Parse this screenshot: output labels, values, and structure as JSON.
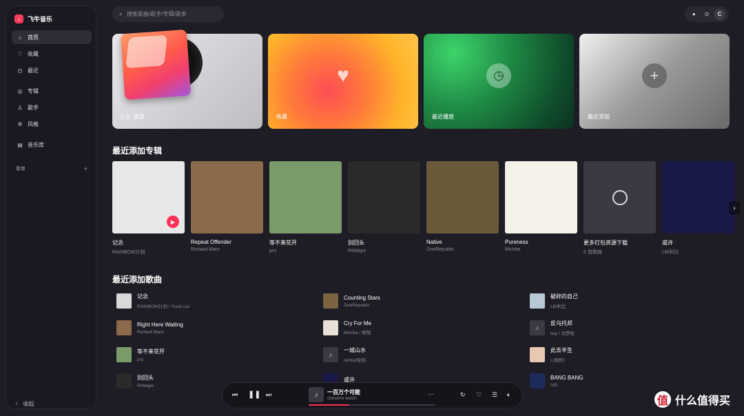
{
  "app": {
    "name": "飞牛音乐"
  },
  "sidebar": {
    "items": [
      {
        "label": "首页",
        "icon": "home-icon"
      },
      {
        "label": "收藏",
        "icon": "heart-icon"
      },
      {
        "label": "最近",
        "icon": "clock-icon"
      },
      {
        "label": "专辑",
        "icon": "album-icon"
      },
      {
        "label": "歌手",
        "icon": "singer-icon"
      },
      {
        "label": "风格",
        "icon": "genre-icon"
      },
      {
        "label": "音乐库",
        "icon": "library-icon"
      }
    ],
    "playlist_label": "歌单",
    "playlist_add": "+",
    "collapse_label": "收起"
  },
  "search": {
    "placeholder": "搜索歌曲/歌手/专辑/歌单"
  },
  "top_controls": {
    "avatar": "C"
  },
  "cards": [
    {
      "label": "漫游",
      "icon": "radio-icon"
    },
    {
      "label": "收藏",
      "icon": "heart-icon"
    },
    {
      "label": "最近播放",
      "icon": "clock-icon"
    },
    {
      "label": "最近添加",
      "icon": "plus-icon"
    }
  ],
  "albums_section": {
    "title": "最近添加专辑"
  },
  "albums": [
    {
      "title": "记念",
      "artist": "RAINBOW计划",
      "color": "#e8e8e8"
    },
    {
      "title": "Repeat Offender",
      "artist": "Richard Marx",
      "color": "#8a6a4a"
    },
    {
      "title": "等不来花开",
      "artist": "pro",
      "color": "#7a9a6a"
    },
    {
      "title": "别回头",
      "artist": "PAMajor",
      "color": "#2a2a2a"
    },
    {
      "title": "Native",
      "artist": "OneRepublic",
      "color": "#6a5a3a"
    },
    {
      "title": "Pureness",
      "artist": "Michita",
      "color": "#f5f0e8"
    },
    {
      "title": "更多打包资源下载",
      "artist": "5 首歌曲",
      "color": "#3a3944"
    },
    {
      "title": "或许",
      "artist": "LBI利比",
      "color": "#1a1a4a"
    }
  ],
  "songs_section": {
    "title": "最近添加歌曲"
  },
  "songs": [
    {
      "name": "记念",
      "artist": "RAINBOW计划 / Yuxin Lei",
      "color": "#d9d9dc"
    },
    {
      "name": "Counting Stars",
      "artist": "OneRepublic",
      "color": "#7a6540"
    },
    {
      "name": "破碎的自己",
      "artist": "LBI利比",
      "color": "#b9c9d4"
    },
    {
      "name": "Right Here Waiting",
      "artist": "Richard Marx",
      "color": "#8a6a4a"
    },
    {
      "name": "Cry For Me",
      "artist": "Michita / 姬翔",
      "color": "#e8e2d6"
    },
    {
      "name": "反乌托邦",
      "artist": "key / 沈梦柱",
      "color": "#3a3944"
    },
    {
      "name": "等不来花开",
      "artist": "pro",
      "color": "#7a9a6a"
    },
    {
      "name": "一城山水",
      "artist": "lunhui/轮回",
      "color": "#3a3944"
    },
    {
      "name": "此去半生",
      "artist": "L(桃籽)",
      "color": "#e8c8b0"
    },
    {
      "name": "别回头",
      "artist": "PAMajor",
      "color": "#2a2a2a"
    },
    {
      "name": "或许",
      "artist": "",
      "color": "#1a1a4a"
    },
    {
      "name": "BANG BANG",
      "artist": "IVE",
      "color": "#1e2a5a"
    }
  ],
  "player": {
    "title": "一百万个可能",
    "artist": "christine welch",
    "more": "···",
    "progress": 0.32
  },
  "watermark": {
    "logo": "值",
    "text": "什么值得买"
  }
}
